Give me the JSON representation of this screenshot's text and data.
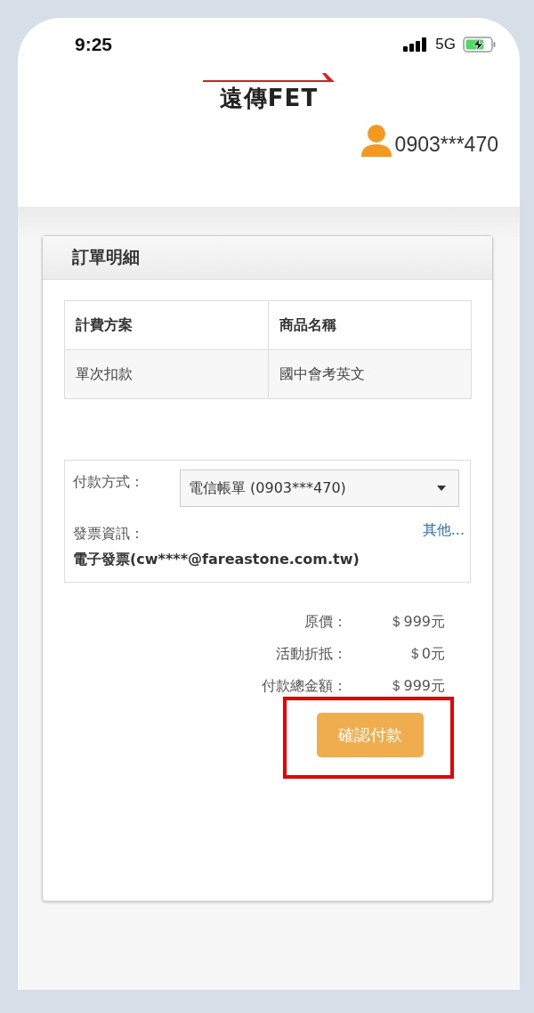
{
  "status_bar": {
    "time": "9:25",
    "network": "5G"
  },
  "header": {
    "logo": "遠傳FET",
    "account": "0903***470"
  },
  "card": {
    "title": "訂單明細",
    "table": {
      "columns": [
        "計費方案",
        "商品名稱"
      ],
      "rows": [
        [
          "單次扣款",
          "國中會考英文"
        ]
      ]
    },
    "payment": {
      "label": "付款方式：",
      "value": "電信帳單 (0903***470)"
    },
    "invoice": {
      "label": "發票資訊：",
      "link": "其他...",
      "value": "電子發票(cw****@fareastone.com.tw)"
    },
    "summary": [
      {
        "label": "原價：",
        "value": "＄999元"
      },
      {
        "label": "活動折抵：",
        "value": "＄0元"
      },
      {
        "label": "付款總金額：",
        "value": "＄999元"
      }
    ],
    "confirm_button": {
      "label": "確認付款",
      "highlighted": true
    }
  }
}
